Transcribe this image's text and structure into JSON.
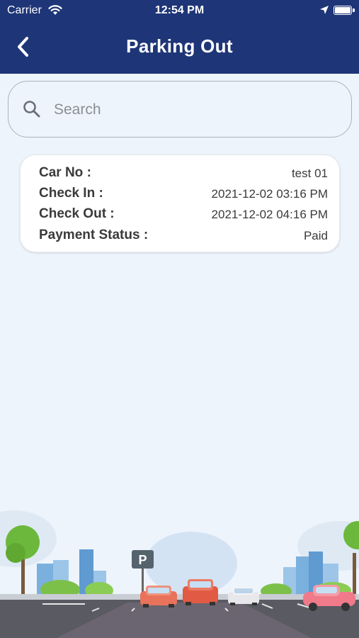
{
  "status_bar": {
    "carrier": "Carrier",
    "time": "12:54 PM"
  },
  "header": {
    "title": "Parking Out",
    "color": "#1e3577"
  },
  "search": {
    "placeholder": "Search",
    "value": ""
  },
  "record": {
    "car_no_label": "Car No :",
    "car_no": "test 01",
    "check_in_label": "Check In :",
    "check_in": "2021-12-02 03:16 PM",
    "check_out_label": "Check Out :",
    "check_out": "2021-12-02 04:16 PM",
    "payment_status_label": "Payment Status :",
    "payment_status": "Paid"
  },
  "scenery": {
    "parking_sign": "P"
  }
}
